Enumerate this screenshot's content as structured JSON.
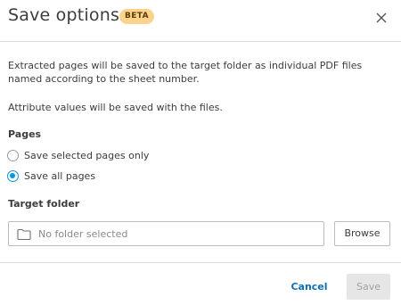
{
  "dialog": {
    "title": "Save options",
    "badge": "BETA",
    "description_1": "Extracted pages will be saved to the target folder as individual PDF files named according to the sheet number.",
    "description_2": "Attribute values will be saved with the files."
  },
  "pages": {
    "label": "Pages",
    "options": [
      {
        "label": "Save selected pages only",
        "selected": false
      },
      {
        "label": "Save all pages",
        "selected": true
      }
    ]
  },
  "target_folder": {
    "label": "Target folder",
    "placeholder": "No folder selected",
    "browse_label": "Browse"
  },
  "footer": {
    "cancel_label": "Cancel",
    "save_label": "Save",
    "save_enabled": false
  },
  "colors": {
    "accent": "#0696d7",
    "link": "#0f6fb0",
    "badge_bg": "#fbd38d"
  },
  "icons": {
    "close": "close-icon",
    "folder": "folder-icon"
  }
}
